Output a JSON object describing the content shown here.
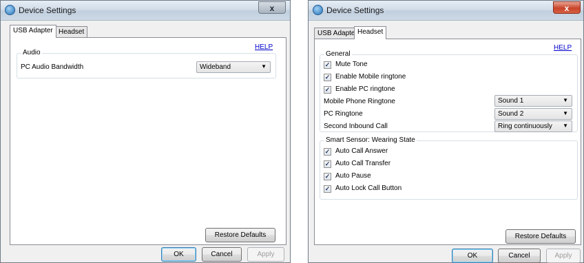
{
  "left_window": {
    "title": "Device Settings",
    "close_glyph": "x",
    "tabs": [
      "USB Adapter",
      "Headset"
    ],
    "help": "HELP",
    "audio_group": {
      "legend": "Audio",
      "bandwidth_label": "PC Audio Bandwidth",
      "bandwidth_value": "Wideband"
    },
    "restore_defaults": "Restore Defaults",
    "ok": "OK",
    "cancel": "Cancel",
    "apply": "Apply"
  },
  "right_window": {
    "title": "Device Settings",
    "close_glyph": "x",
    "tabs": [
      "USB Adapter",
      "Headset"
    ],
    "help": "HELP",
    "general": {
      "legend": "General",
      "checkboxes": [
        {
          "label": "Mute Tone",
          "checked": true
        },
        {
          "label": "Enable Mobile ringtone",
          "checked": true
        },
        {
          "label": "Enable PC ringtone",
          "checked": true
        }
      ],
      "mobile_ringtone_label": "Mobile Phone Ringtone",
      "mobile_ringtone_value": "Sound 1",
      "pc_ringtone_label": "PC Ringtone",
      "pc_ringtone_value": "Sound 2",
      "second_inbound_label": "Second Inbound Call",
      "second_inbound_value": "Ring continuously"
    },
    "smart_sensor": {
      "legend": "Smart Sensor: Wearing State",
      "checkboxes": [
        {
          "label": "Auto Call Answer",
          "checked": true
        },
        {
          "label": "Auto Call Transfer",
          "checked": true
        },
        {
          "label": "Auto Pause",
          "checked": true
        },
        {
          "label": "Auto Lock Call Button",
          "checked": true
        }
      ]
    },
    "restore_defaults": "Restore Defaults",
    "ok": "OK",
    "cancel": "Cancel",
    "apply": "Apply"
  },
  "icons": {
    "app": "headset-app-icon",
    "close": "close-icon",
    "dropdown": "chevron-down-icon",
    "check": "checkmark-icon"
  },
  "colors": {
    "help_link": "#0000cc",
    "close_active": "#c9452a"
  }
}
